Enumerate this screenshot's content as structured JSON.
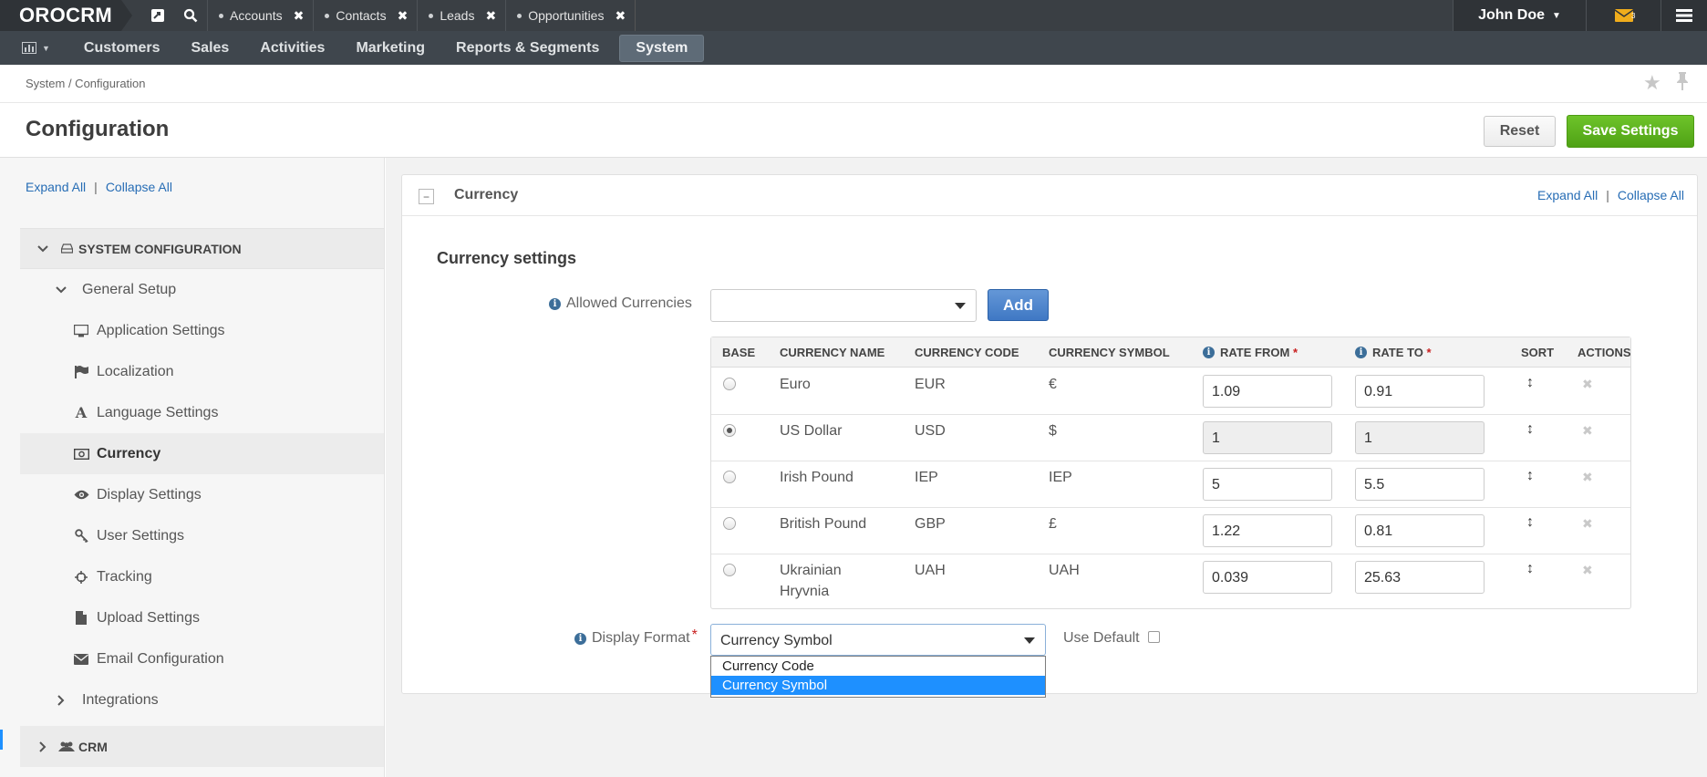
{
  "topbar": {
    "logo": "OROCRM",
    "tabs": [
      "Accounts",
      "Contacts",
      "Leads",
      "Opportunities"
    ],
    "user": "John Doe",
    "mail_count": "3"
  },
  "nav": {
    "items": [
      "Customers",
      "Sales",
      "Activities",
      "Marketing",
      "Reports & Segments",
      "System"
    ],
    "active": "System"
  },
  "breadcrumb": "System / Configuration",
  "page": {
    "title": "Configuration",
    "reset_label": "Reset",
    "save_label": "Save Settings"
  },
  "sidebar": {
    "expand_all": "Expand All",
    "separator": "|",
    "collapse_all": "Collapse All",
    "system_configuration": "SYSTEM CONFIGURATION",
    "general_setup": "General Setup",
    "items": [
      {
        "label": "Application Settings",
        "icon": "desktop-icon"
      },
      {
        "label": "Localization",
        "icon": "flag-icon"
      },
      {
        "label": "Language Settings",
        "icon": "font-icon"
      },
      {
        "label": "Currency",
        "icon": "money-icon"
      },
      {
        "label": "Display Settings",
        "icon": "eye-icon"
      },
      {
        "label": "User Settings",
        "icon": "key-icon"
      },
      {
        "label": "Tracking",
        "icon": "crosshair-icon"
      },
      {
        "label": "Upload Settings",
        "icon": "file-icon"
      },
      {
        "label": "Email Configuration",
        "icon": "envelope-icon"
      }
    ],
    "integrations": "Integrations",
    "crm": "CRM"
  },
  "panel": {
    "title": "Currency",
    "expand_all": "Expand All",
    "separator": "|",
    "collapse_all": "Collapse All",
    "section_title": "Currency settings",
    "allowed_label": "Allowed Currencies",
    "add_label": "Add",
    "table": {
      "headers": [
        "BASE",
        "CURRENCY NAME",
        "CURRENCY CODE",
        "CURRENCY SYMBOL",
        "RATE FROM",
        "RATE TO",
        "SORT",
        "ACTIONS"
      ],
      "required_mark": "*",
      "rows": [
        {
          "name": "Euro",
          "code": "EUR",
          "symbol": "€",
          "rate_from": "1.09",
          "rate_to": "0.91",
          "base": false
        },
        {
          "name": "US Dollar",
          "code": "USD",
          "symbol": "$",
          "rate_from": "1",
          "rate_to": "1",
          "base": true
        },
        {
          "name": "Irish Pound",
          "code": "IEP",
          "symbol": "IEP",
          "rate_from": "5",
          "rate_to": "5.5",
          "base": false
        },
        {
          "name": "British Pound",
          "code": "GBP",
          "symbol": "£",
          "rate_from": "1.22",
          "rate_to": "0.81",
          "base": false
        },
        {
          "name": "Ukrainian Hryvnia",
          "code": "UAH",
          "symbol": "UAH",
          "rate_from": "0.039",
          "rate_to": "25.63",
          "base": false
        }
      ]
    },
    "display_format_label": "Display Format",
    "display_format_value": "Currency Symbol",
    "display_format_options": [
      "Currency Code",
      "Currency Symbol"
    ],
    "use_default_label": "Use Default"
  }
}
